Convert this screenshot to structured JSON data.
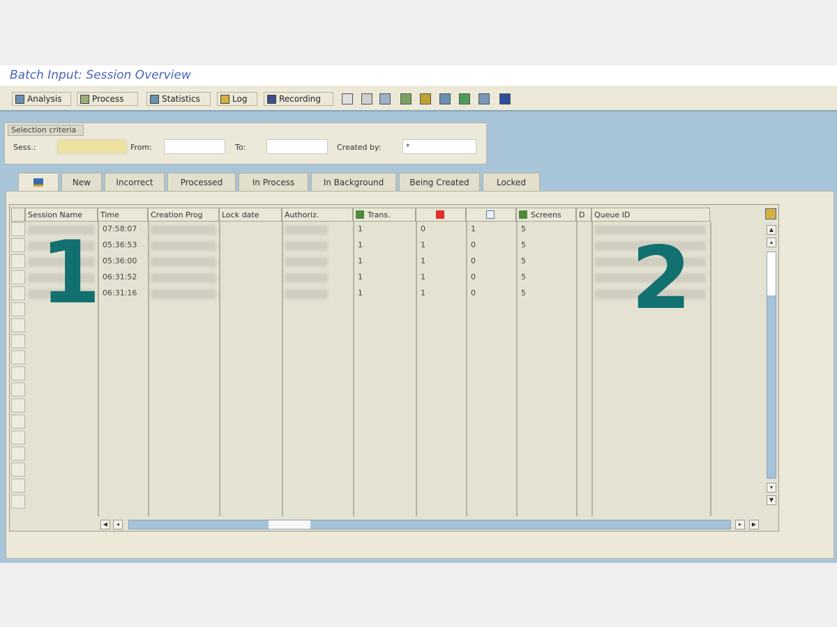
{
  "window": {
    "title": "Batch Input: Session Overview"
  },
  "toolbar": {
    "buttons": [
      {
        "label": "Analysis"
      },
      {
        "label": "Process"
      },
      {
        "label": "Statistics"
      },
      {
        "label": "Log"
      },
      {
        "label": "Recording"
      }
    ]
  },
  "selection": {
    "caption": "Selection criteria",
    "sess_label": "Sess.:",
    "from_label": "From:",
    "to_label": "To:",
    "created_by_label": "Created by:",
    "created_by_value": "*"
  },
  "tabs": [
    "",
    "New",
    "Incorrect",
    "Processed",
    "In Process",
    "In Background",
    "Being Created",
    "Locked"
  ],
  "table": {
    "headers": [
      "Session Name",
      "Time",
      "Creation Prog",
      "Lock date",
      "Authoriz.",
      "Trans.",
      "",
      "",
      "Screens",
      "D",
      "Queue ID"
    ],
    "rows": [
      {
        "time": "07:58:07",
        "a": "1",
        "b": "0",
        "c": "1",
        "d": "5"
      },
      {
        "time": "05:36:53",
        "a": "1",
        "b": "1",
        "c": "0",
        "d": "5"
      },
      {
        "time": "05:36:00",
        "a": "1",
        "b": "1",
        "c": "0",
        "d": "5"
      },
      {
        "time": "06:31:52",
        "a": "1",
        "b": "1",
        "c": "0",
        "d": "5"
      },
      {
        "time": "06:31:16",
        "a": "1",
        "b": "1",
        "c": "0",
        "d": "5"
      }
    ]
  },
  "annotations": {
    "left": "1",
    "right": "2"
  }
}
